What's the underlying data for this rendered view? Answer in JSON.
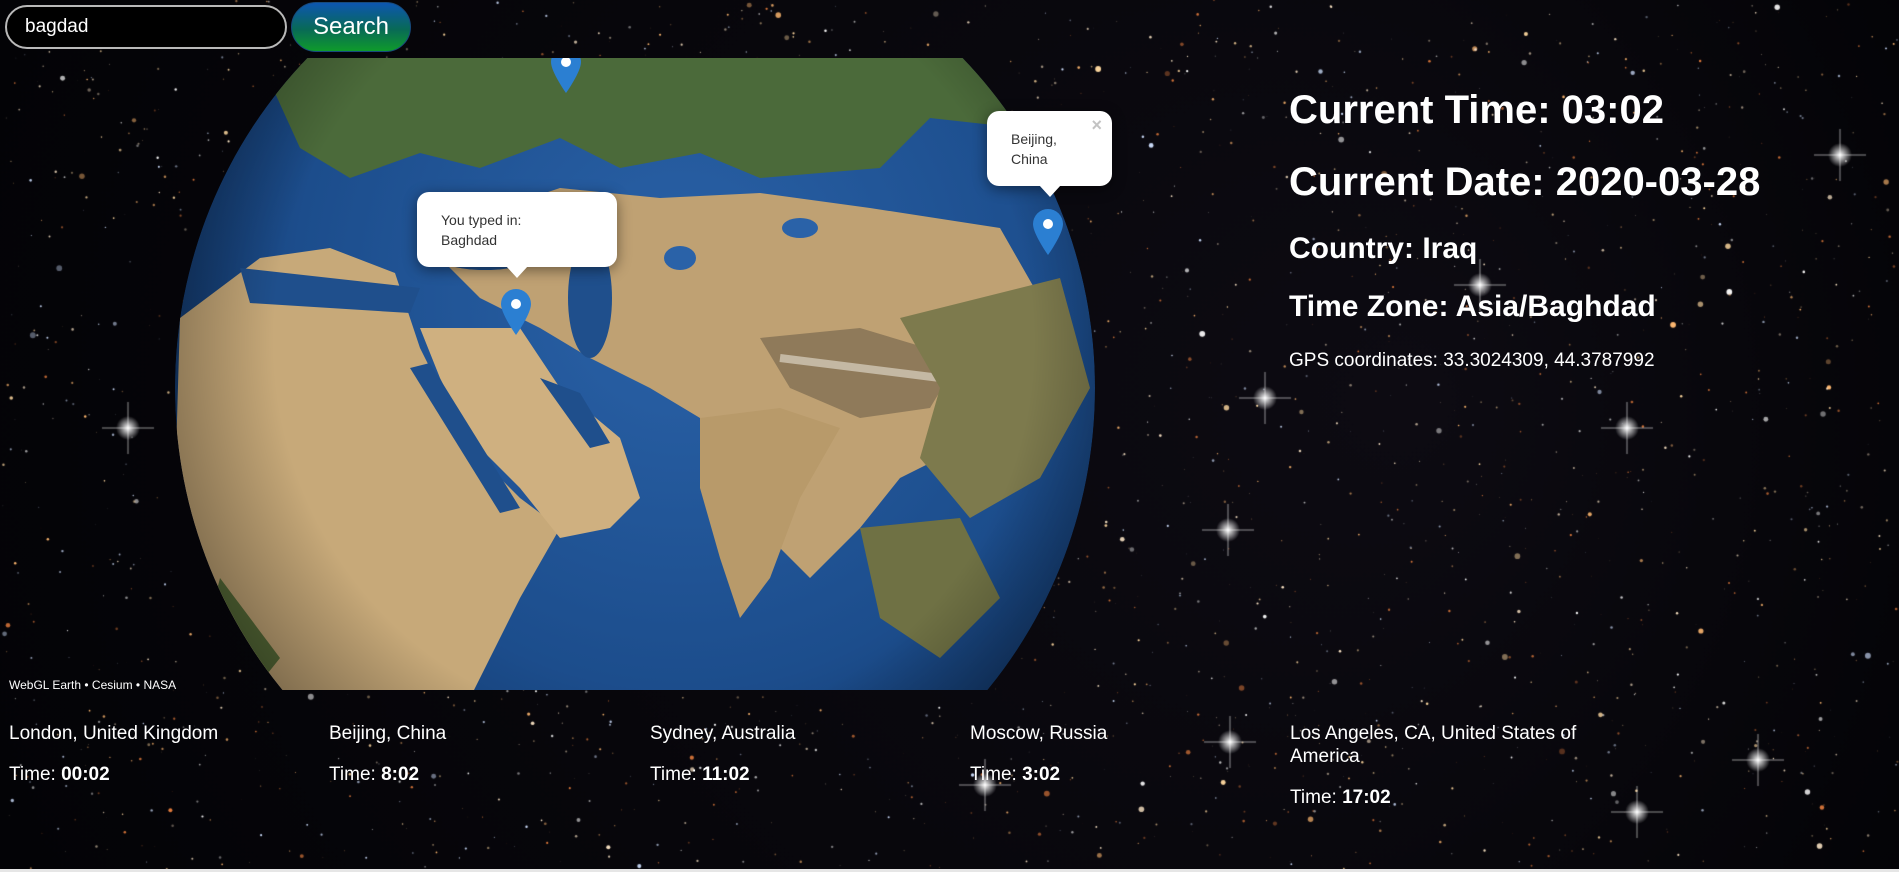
{
  "search": {
    "value": "bagdad",
    "button_label": "Search"
  },
  "globe": {
    "attribution": "WebGL Earth • Cesium • NASA",
    "markers": [
      {
        "name": "Baghdad",
        "popup": [
          "You typed in:",
          "Baghdad"
        ],
        "closable": false
      },
      {
        "name": "Beijing",
        "popup": [
          "Beijing,",
          "China"
        ],
        "closable": true
      }
    ],
    "close_glyph": "×",
    "colors": {
      "pin": "#2b7fd2",
      "ocean": "#1d4f8f",
      "desert": "#c9ad7f",
      "forest": "#4f6a3b"
    }
  },
  "info": {
    "current_time": "Current Time: 03:02",
    "current_date": "Current Date: 2020-03-28",
    "country": "Country: Iraq",
    "time_zone": "Time Zone: Asia/Baghdad",
    "gps": "GPS coordinates: 33.3024309, 44.3787992"
  },
  "cities": [
    {
      "name": "London, United Kingdom",
      "time_label": "Time:",
      "time": "00:02"
    },
    {
      "name": "Beijing, China",
      "time_label": "Time:",
      "time": "8:02"
    },
    {
      "name": "Sydney, Australia",
      "time_label": "Time:",
      "time": "11:02"
    },
    {
      "name": "Moscow, Russia",
      "time_label": "Time:",
      "time": "3:02"
    },
    {
      "name": "Los Angeles, CA, United States of America",
      "time_label": "Time:",
      "time": "17:02"
    }
  ]
}
